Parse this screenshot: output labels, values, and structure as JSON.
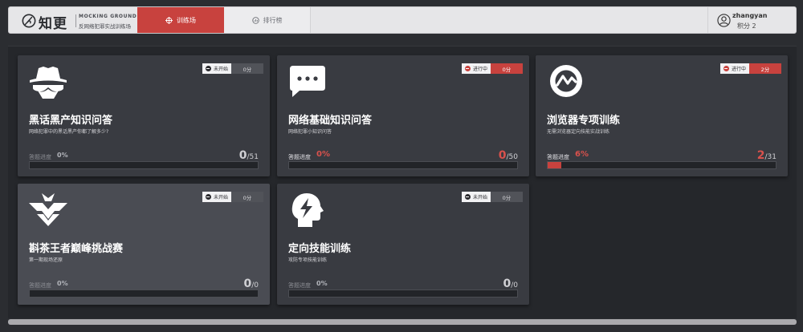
{
  "logo": {
    "name": "知更",
    "en": "MOCKING GROUND",
    "cn": "反网络犯罪实战训练场"
  },
  "nav": {
    "tabs": [
      {
        "label": "训练场",
        "active": true,
        "icon": "crosshair-icon"
      },
      {
        "label": "排行榜",
        "active": false,
        "icon": "rank-icon"
      }
    ]
  },
  "user": {
    "name": "zhangyan",
    "score": "积分 2",
    "icon": "user-avatar-icon"
  },
  "colors": {
    "accent": "#c8423e",
    "background": "#2b2d31",
    "card": "#393b41"
  },
  "cards": [
    {
      "title": "黑话黑产知识问答",
      "subtitle": "网络犯罪中的黑话黑产你都了解多少?",
      "status": "未开始",
      "score": "0分",
      "progress_label": "答题进度",
      "progress_percent": "0%",
      "done": "0",
      "total": "/51",
      "fraction": 0,
      "icon": "spy-icon"
    },
    {
      "title": "网络基础知识问答",
      "subtitle": "网络犯罪小知识问答",
      "status": "进行中",
      "score": "0分",
      "progress_label": "答题进度",
      "progress_percent": "0%",
      "done": "0",
      "total": "/50",
      "fraction": 0,
      "icon": "chat-bubble-icon"
    },
    {
      "title": "浏览器专项训练",
      "subtitle": "无需浏览器定向技能实战训练",
      "status": "进行中",
      "score": "2分",
      "progress_label": "答题进度",
      "progress_percent": "6%",
      "done": "2",
      "total": "/31",
      "fraction": 0.06,
      "icon": "browser-icon"
    },
    {
      "title": "斟茶王者巅峰挑战赛",
      "subtitle": "第一期现场还原",
      "status": "未开始",
      "score": "0分",
      "progress_label": "答题进度",
      "progress_percent": "0%",
      "done": "0",
      "total": "/0",
      "fraction": 0,
      "icon": "emblem-icon"
    },
    {
      "title": "定向技能训练",
      "subtitle": "攻防专项技能训练",
      "status": "未开始",
      "score": "0分",
      "progress_label": "答题进度",
      "progress_percent": "0%",
      "done": "0",
      "total": "/0",
      "fraction": 0,
      "icon": "brain-bolt-icon"
    }
  ]
}
